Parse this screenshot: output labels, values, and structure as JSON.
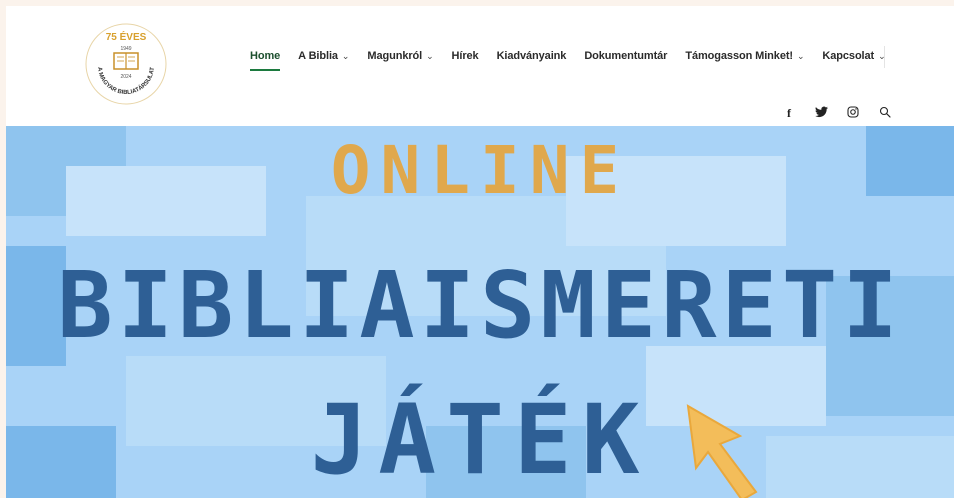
{
  "logo": {
    "anniversary": "75 ÉVES",
    "year_start": "1949",
    "year_end": "2024",
    "org": "A MAGYAR BIBLIATÁRSULAT"
  },
  "nav": {
    "items": [
      {
        "label": "Home",
        "dropdown": false,
        "active": true
      },
      {
        "label": "A Biblia",
        "dropdown": true,
        "active": false
      },
      {
        "label": "Magunkról",
        "dropdown": true,
        "active": false
      },
      {
        "label": "Hírek",
        "dropdown": false,
        "active": false
      },
      {
        "label": "Kiadványaink",
        "dropdown": false,
        "active": false
      },
      {
        "label": "Dokumentumtár",
        "dropdown": false,
        "active": false
      },
      {
        "label": "Támogasson Minket!",
        "dropdown": true,
        "active": false
      },
      {
        "label": "Kapcsolat",
        "dropdown": true,
        "active": false
      }
    ]
  },
  "social": {
    "facebook": "f",
    "twitter": "twitter-icon",
    "instagram": "instagram-icon",
    "search": "search-icon"
  },
  "hero": {
    "line1": "ONLINE",
    "line2": "BIBLIAISMERETI",
    "line3": "JÁTÉK"
  },
  "colors": {
    "accent_green": "#1c7a3f",
    "hero_bg": "#a9d3f7",
    "hero_gold": "#e0a84c",
    "hero_blue": "#2e5f95",
    "logo_gold": "#d8a02c"
  }
}
